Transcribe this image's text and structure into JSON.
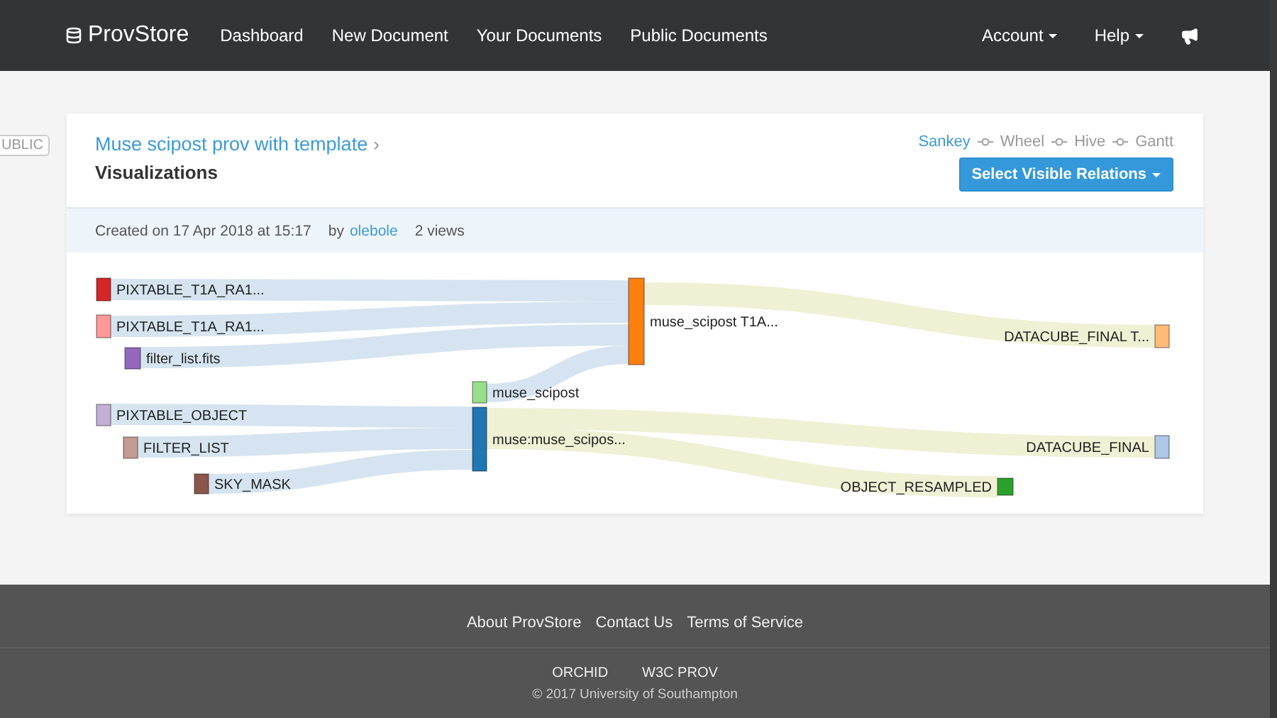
{
  "navbar": {
    "brand": "ProvStore",
    "links": [
      {
        "label": "Dashboard"
      },
      {
        "label": "New Document"
      },
      {
        "label": "Your Documents"
      },
      {
        "label": "Public Documents"
      }
    ],
    "menus": [
      {
        "label": "Account"
      },
      {
        "label": "Help"
      }
    ]
  },
  "badge": "UBLIC",
  "document": {
    "title": "Muse scipost prov with template",
    "separator": "›",
    "subtitle": "Visualizations",
    "views": [
      {
        "label": "Sankey",
        "selected": true
      },
      {
        "label": "Wheel",
        "selected": false
      },
      {
        "label": "Hive",
        "selected": false
      },
      {
        "label": "Gantt",
        "selected": false
      }
    ],
    "button": "Select Visible Relations",
    "meta": {
      "created": "Created on 17 Apr 2018 at 15:17",
      "by": "by",
      "author": "olebole",
      "views": "2 views"
    }
  },
  "sankey": {
    "nodes": [
      {
        "label": "PIXTABLE_T1A_RA1...",
        "color": "#d62728"
      },
      {
        "label": "PIXTABLE_T1A_RA1...",
        "color": "#ff9896"
      },
      {
        "label": "filter_list.fits",
        "color": "#9467bd"
      },
      {
        "label": "muse_scipost",
        "color": "#98df8a"
      },
      {
        "label": "PIXTABLE_OBJECT",
        "color": "#c5b0d5"
      },
      {
        "label": "FILTER_LIST",
        "color": "#c49c94"
      },
      {
        "label": "SKY_MASK",
        "color": "#8c564b"
      },
      {
        "label": "muse:muse_scipos...",
        "color": "#1f77b4"
      },
      {
        "label": "muse_scipost T1A...",
        "color": "#ff7f0e"
      },
      {
        "label": "DATACUBE_FINAL T...",
        "color": "#ffbb78"
      },
      {
        "label": "DATACUBE_FINAL",
        "color": "#aec7e8"
      },
      {
        "label": "OBJECT_RESAMPLED",
        "color": "#2ca02c"
      }
    ],
    "links": [
      {
        "kind": "input"
      },
      {
        "kind": "input"
      },
      {
        "kind": "input"
      },
      {
        "kind": "input"
      },
      {
        "kind": "input"
      },
      {
        "kind": "input"
      },
      {
        "kind": "input"
      },
      {
        "kind": "output"
      },
      {
        "kind": "output"
      },
      {
        "kind": "output"
      }
    ]
  },
  "footer": {
    "links": [
      {
        "label": "About ProvStore"
      },
      {
        "label": "Contact Us"
      },
      {
        "label": "Terms of Service"
      }
    ],
    "projects": [
      {
        "label": "ORCHID"
      },
      {
        "label": "W3C PROV"
      }
    ],
    "copyright": "© 2017 University of Southampton"
  }
}
